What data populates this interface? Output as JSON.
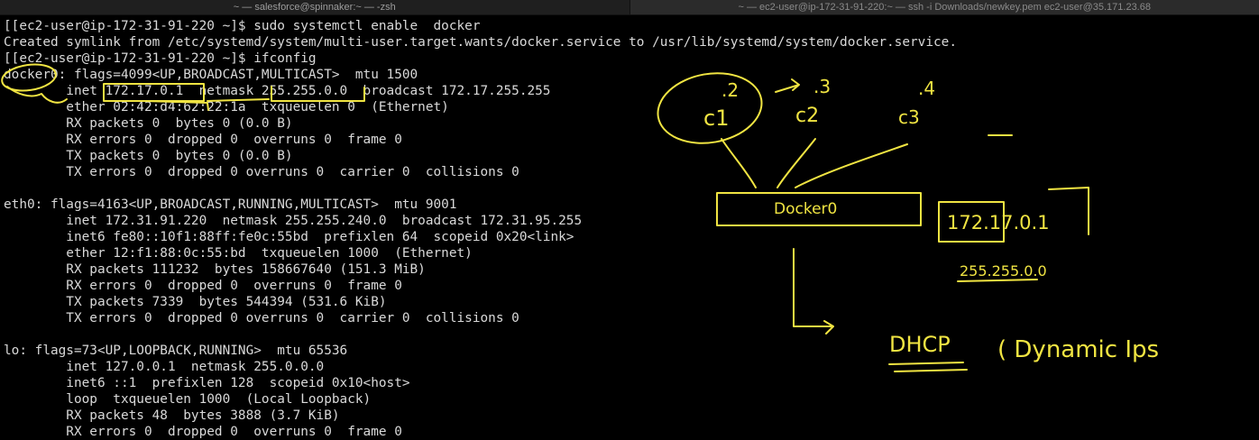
{
  "window": {
    "tabs": [
      "~ — salesforce@spinnaker:~ — -zsh",
      "~ — ec2-user@ip-172-31-91-220:~ — ssh -i Downloads/newkey.pem ec2-user@35.171.23.68"
    ],
    "active_tab": 0
  },
  "terminal": {
    "lines": [
      "[[ec2-user@ip-172-31-91-220 ~]$ sudo systemctl enable  docker",
      "Created symlink from /etc/systemd/system/multi-user.target.wants/docker.service to /usr/lib/systemd/system/docker.service.",
      "[[ec2-user@ip-172-31-91-220 ~]$ ifconfig",
      "docker0: flags=4099<UP,BROADCAST,MULTICAST>  mtu 1500",
      "        inet 172.17.0.1  netmask 255.255.0.0  broadcast 172.17.255.255",
      "        ether 02:42:d4:62:22:1a  txqueuelen 0  (Ethernet)",
      "        RX packets 0  bytes 0 (0.0 B)",
      "        RX errors 0  dropped 0  overruns 0  frame 0",
      "        TX packets 0  bytes 0 (0.0 B)",
      "        TX errors 0  dropped 0 overruns 0  carrier 0  collisions 0",
      "",
      "eth0: flags=4163<UP,BROADCAST,RUNNING,MULTICAST>  mtu 9001",
      "        inet 172.31.91.220  netmask 255.255.240.0  broadcast 172.31.95.255",
      "        inet6 fe80::10f1:88ff:fe0c:55bd  prefixlen 64  scopeid 0x20<link>",
      "        ether 12:f1:88:0c:55:bd  txqueuelen 1000  (Ethernet)",
      "        RX packets 111232  bytes 158667640 (151.3 MiB)",
      "        RX errors 0  dropped 0  overruns 0  frame 0",
      "        TX packets 7339  bytes 544394 (531.6 KiB)",
      "        TX errors 0  dropped 0 overruns 0  carrier 0  collisions 0",
      "",
      "lo: flags=73<UP,LOOPBACK,RUNNING>  mtu 65536",
      "        inet 127.0.0.1  netmask 255.0.0.0",
      "        inet6 ::1  prefixlen 128  scopeid 0x10<host>",
      "        loop  txqueuelen 1000  (Local Loopback)",
      "        RX packets 48  bytes 3888 (3.7 KiB)",
      "        RX errors 0  dropped 0  overruns 0  frame 0"
    ]
  },
  "sketch": {
    "color": "#f0e442",
    "ip_suffixes": [
      ".2",
      ".3",
      ".4"
    ],
    "containers": [
      "c1",
      "c2",
      "c3"
    ],
    "bridge_label": "Docker0",
    "subnet_ip": "172.17.0.1",
    "subnet_mask": "255.255.0.0",
    "dhcp": "DHCP",
    "dynamic": "( Dynamic Ips"
  }
}
